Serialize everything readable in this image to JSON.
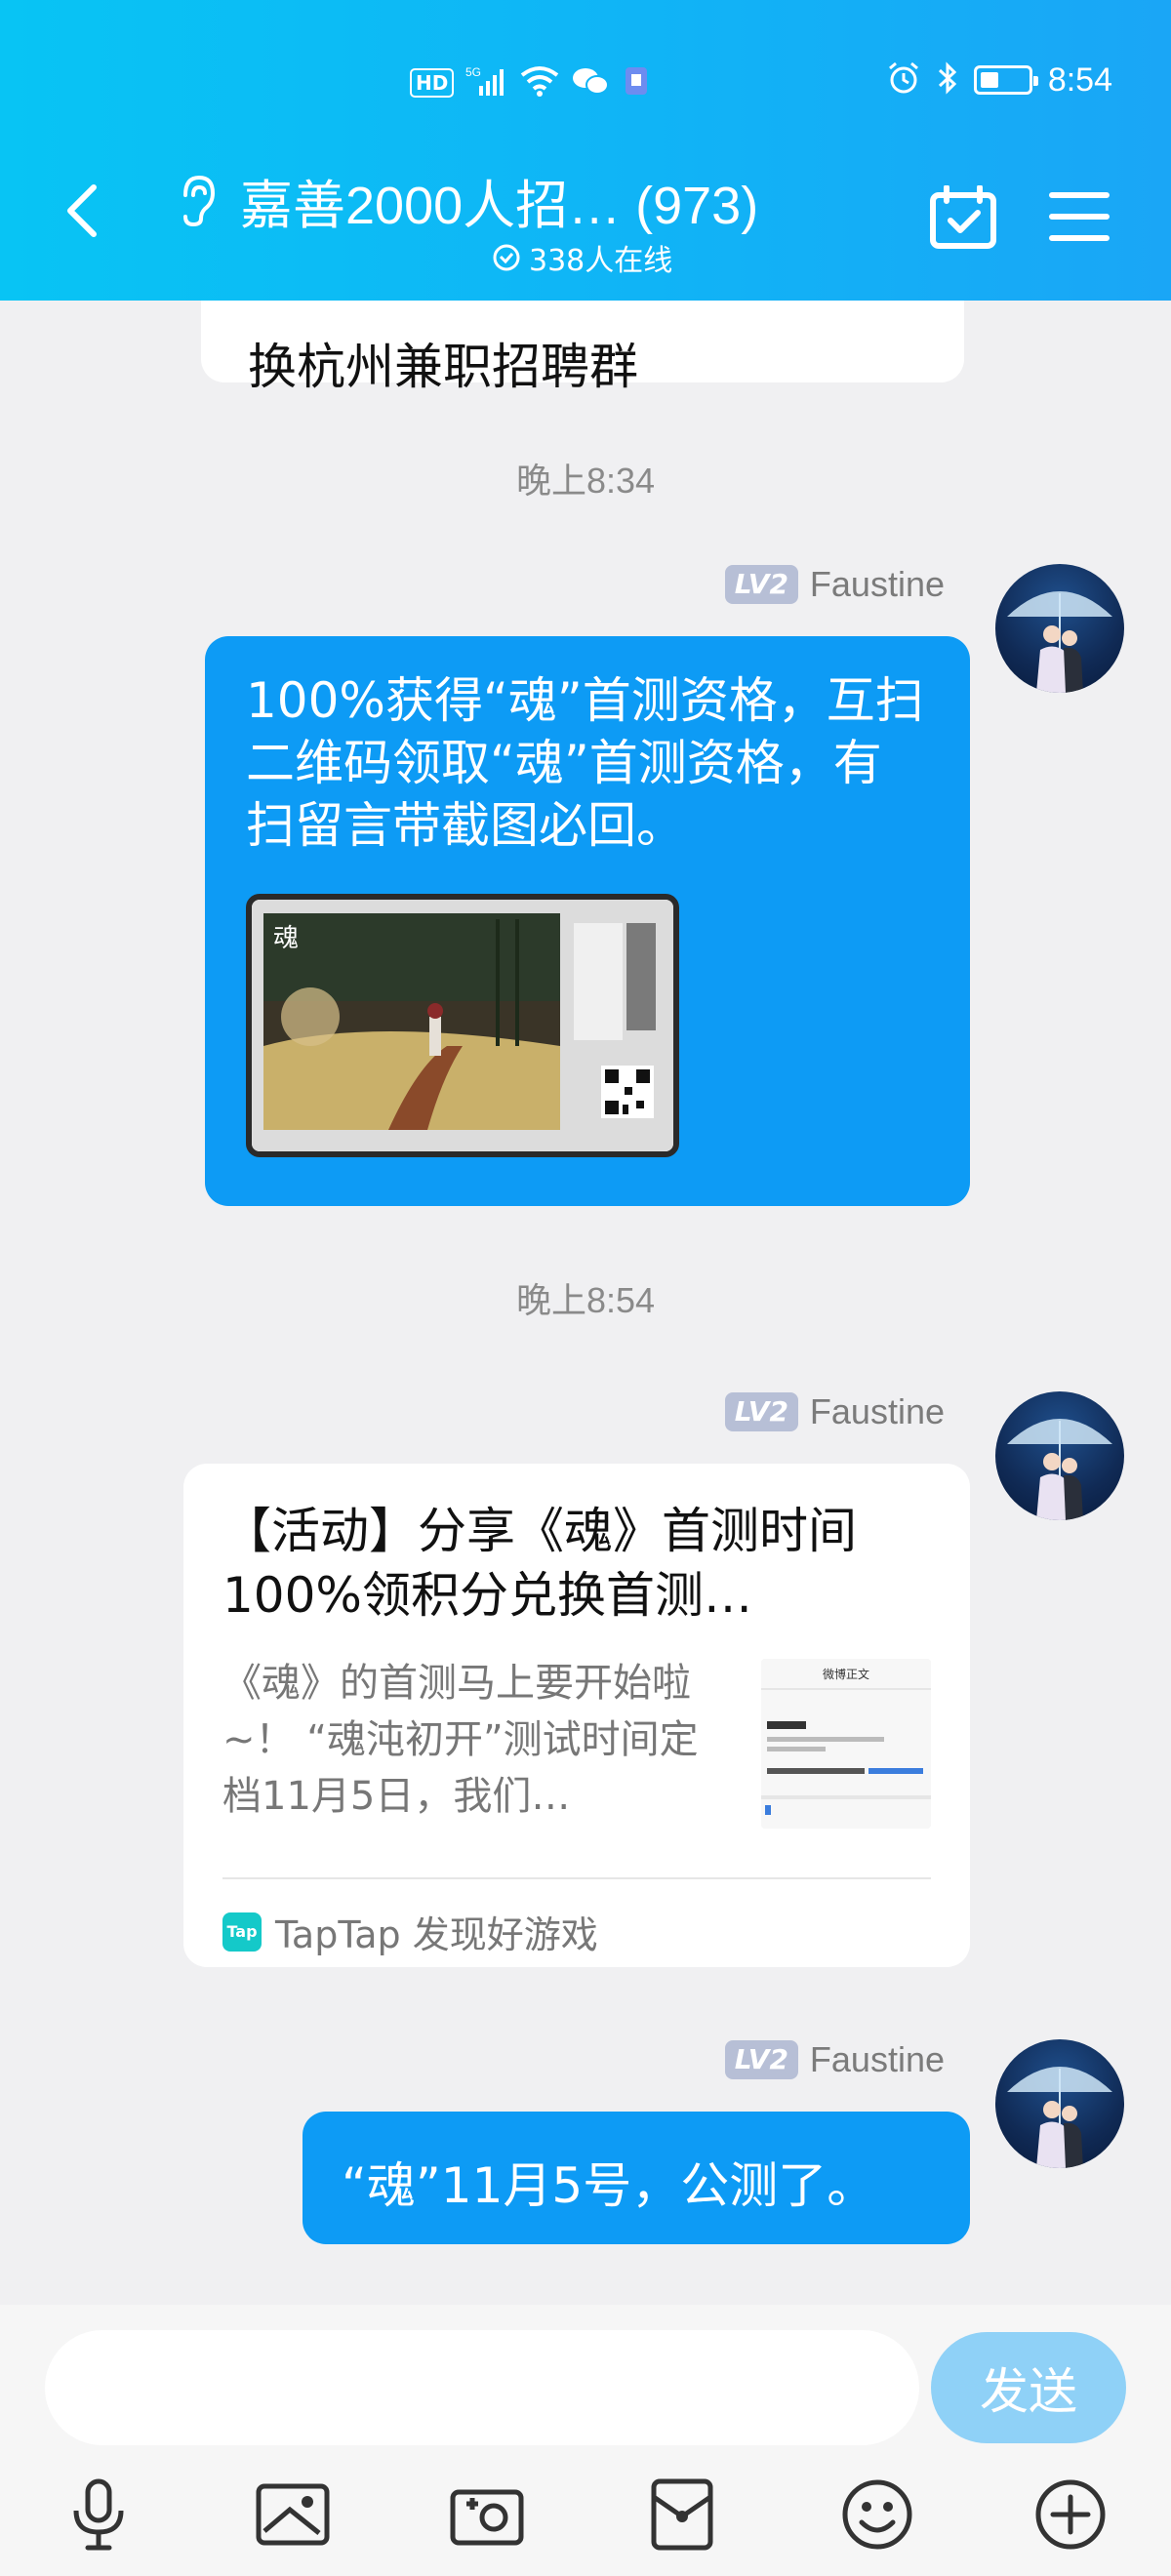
{
  "status_bar": {
    "network_badge": "HD",
    "network_type": "5G",
    "time": "8:54"
  },
  "header": {
    "title": "嘉善2000人招… (973)",
    "online_count": "338人在线"
  },
  "messages": {
    "previous_snippet": "换杭州兼职招聘群",
    "time_1": "晚上8:34",
    "time_2": "晚上8:54",
    "sender_level": "LV2",
    "sender_name": "Faustine",
    "msg1_text": "100%获得“魂”首测资格，互扫二维码领取“魂”首测资格，有扫留言带截图必回。",
    "card": {
      "title": "【活动】分享《魂》首测时间 100%领积分兑换首测…",
      "description": "《魂》的首测马上要开始啦~！ “魂沌初开”测试时间定档11月5日，我们…",
      "thumb_title": "微博正文",
      "source_icon_label": "Tap",
      "source": "TapTap 发现好游戏"
    },
    "msg3_text": "“魂”11月5号，公测了。"
  },
  "input": {
    "placeholder": "",
    "send_label": "发送"
  },
  "toolbar": {
    "icons": [
      "microphone-icon",
      "photo-icon",
      "camera-icon",
      "red-packet-icon",
      "emoji-icon",
      "plus-icon"
    ]
  },
  "colors": {
    "header_start": "#08c4f4",
    "header_end": "#1aa6f6",
    "bubble_blue": "#0d9bf5",
    "send_button": "#8fd1f7",
    "background": "#f0f0f2"
  }
}
